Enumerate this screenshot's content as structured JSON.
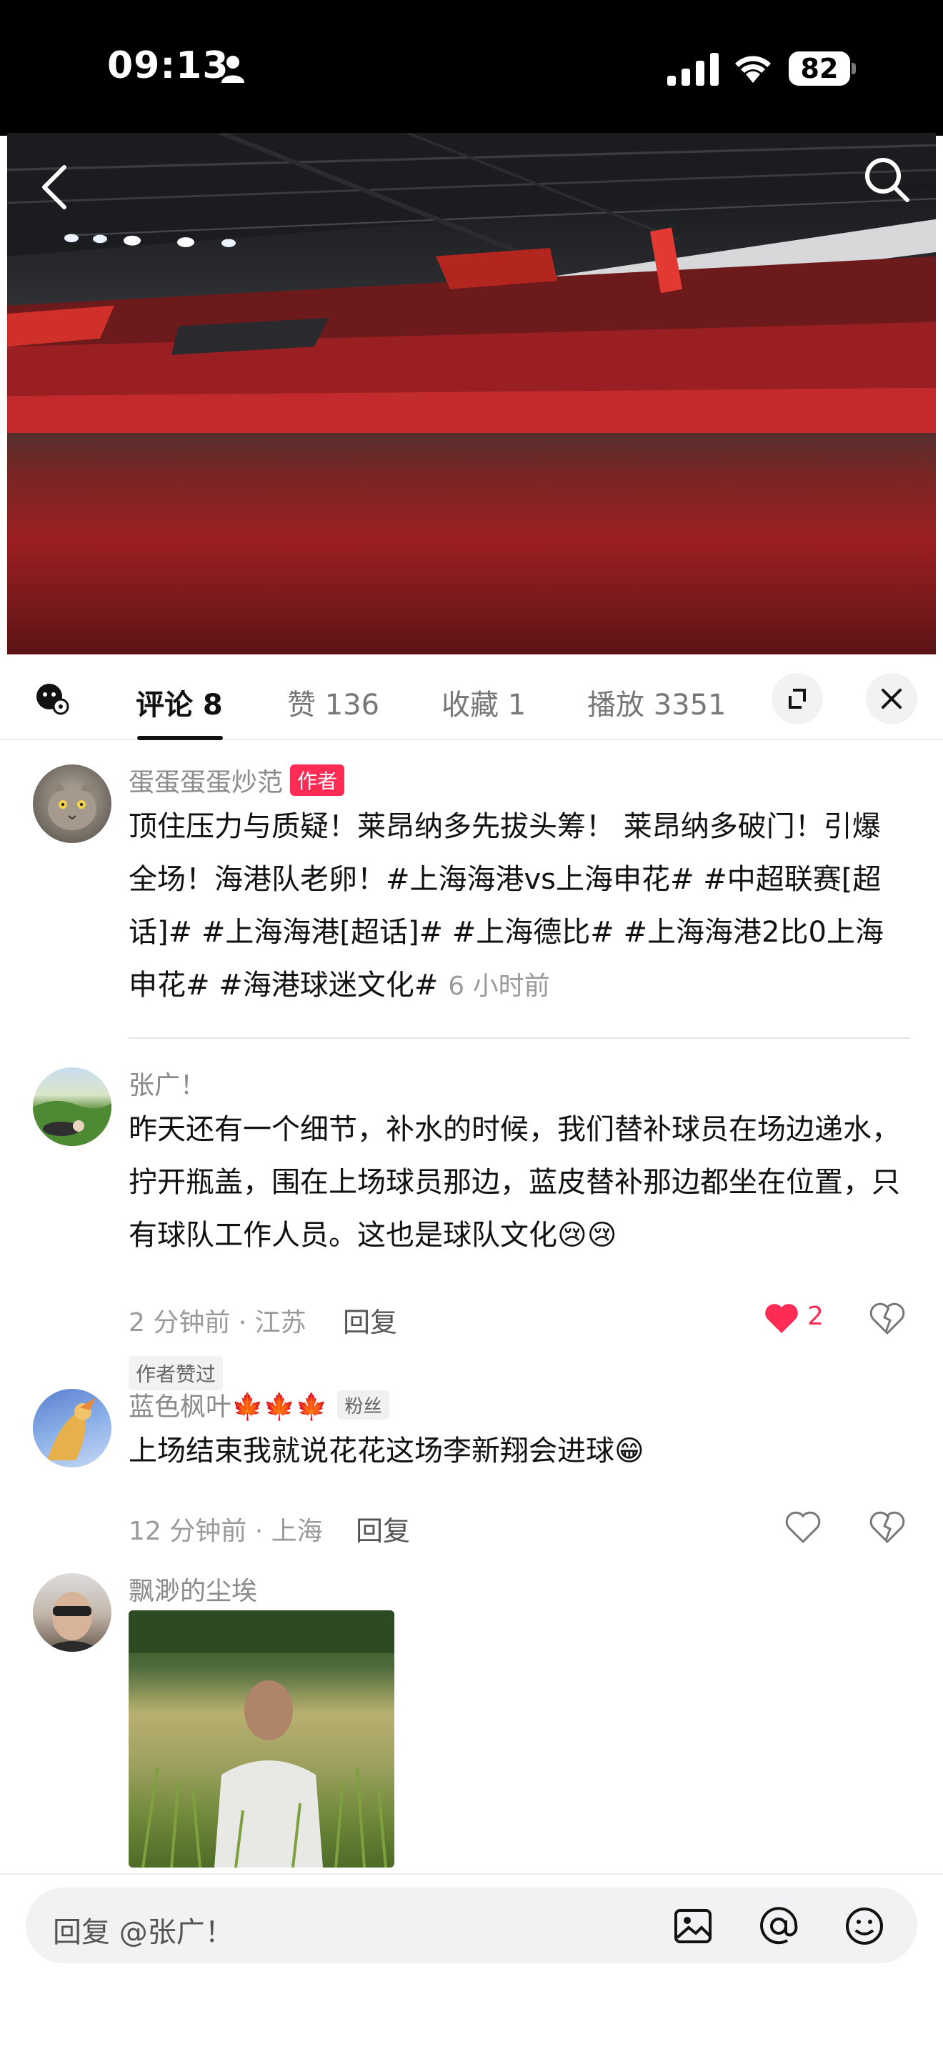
{
  "status_bar": {
    "time": "09:13",
    "battery": "82"
  },
  "tabs": {
    "comments": "评论 8",
    "likes": "赞 136",
    "favorites": "收藏 1",
    "plays": "播放 3351"
  },
  "comments": [
    {
      "name": "蛋蛋蛋蛋炒范",
      "badge": "作者",
      "text": "顶住压力与质疑！莱昂纳多先拔头筹！ 莱昂纳多破门！引爆全场！海港队老卵！#上海海港vs上海申花# #中超联赛[超话]# #上海海港[超话]# #上海德比# #上海海港2比0上海申花# #海港球迷文化#",
      "time": "6 小时前"
    },
    {
      "name": "张广！",
      "text": "昨天还有一个细节，补水的时候，我们替补球员在场边递水，拧开瓶盖，围在上场球员那边，蓝皮替补那边都坐在位置，只有球队工作人员。这也是球队文化😢😢",
      "meta": "2 分钟前 · 江苏",
      "reply": "回复",
      "likes": "2",
      "author_liked": "作者赞过"
    },
    {
      "name": "蓝色枫叶🍁🍁🍁",
      "badge": "粉丝",
      "text": "上场结束我就说花花这场李新翔会进球😁",
      "meta": "12 分钟前 · 上海",
      "reply": "回复"
    },
    {
      "name": "飘渺的尘埃"
    }
  ],
  "input": {
    "placeholder": "回复 @张广！"
  },
  "icons": [
    "back-icon",
    "search-icon",
    "emoji-settings-icon",
    "expand-icon",
    "close-icon",
    "heart-icon",
    "dislike-icon",
    "image-icon",
    "at-icon",
    "emoji-icon"
  ],
  "colors": {
    "accent": "#fe2c55",
    "status_bar": "#000000"
  }
}
